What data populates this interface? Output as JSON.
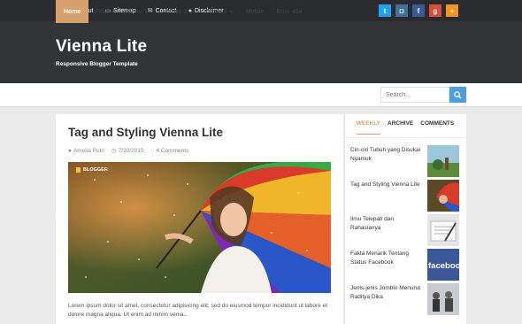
{
  "topbar": {
    "links": [
      {
        "icon": "globe-icon",
        "glyph": "◍",
        "label": "About"
      },
      {
        "icon": "folder-icon",
        "glyph": "▭",
        "label": "Sitemap"
      },
      {
        "icon": "envelope-icon",
        "glyph": "✉",
        "label": "Contact"
      },
      {
        "icon": "info-icon",
        "glyph": "●",
        "label": "Disclaimer"
      }
    ],
    "socials": [
      {
        "name": "twitter",
        "glyph": "t",
        "color": "#1da1f2"
      },
      {
        "name": "instagram",
        "glyph": "◘",
        "color": "#3f729b"
      },
      {
        "name": "facebook",
        "glyph": "f",
        "color": "#3b5998"
      },
      {
        "name": "google-plus",
        "glyph": "g",
        "color": "#dd4b39"
      },
      {
        "name": "rss",
        "glyph": "+",
        "color": "#f7931e"
      }
    ]
  },
  "header": {
    "title": "Vienna Lite",
    "description": "Responsive Blogger Template"
  },
  "nav": {
    "items": [
      {
        "label": "Home",
        "dropdown": false
      },
      {
        "label": "Fitur",
        "dropdown": true
      },
      {
        "label": "Menu 1",
        "dropdown": true
      },
      {
        "label": "Menu 2",
        "dropdown": true
      },
      {
        "label": "Menu 3",
        "dropdown": true
      },
      {
        "label": "Mobile",
        "dropdown": false
      },
      {
        "label": "Error 404",
        "dropdown": false
      }
    ],
    "search_placeholder": "Search..."
  },
  "post": {
    "title": "Tag and Styling Vienna Lite",
    "author": "Amelia Putri",
    "date": "7/30/2015",
    "comments": "4 Comments",
    "label": "BLOGGER",
    "excerpt": "Lorem ipsum dolor sit amet, consectetur adipisicing elit, sed do eiusmod tempor incididunt ut labore et dolore magna aliqua. Ut enim ad minim venia..."
  },
  "sidebar": {
    "tabs": [
      "WEEKLY",
      "ARCHIVE",
      "COMMENTS"
    ],
    "items": [
      {
        "title": "Ciri-ciri Tubuh yang Disukai Nyamuk"
      },
      {
        "title": "Tag and Styling Vienna Lite"
      },
      {
        "title": "Ilmu Telepati dan Rahasianya"
      },
      {
        "title": "Fakta Menarik Tentang Status Facebook",
        "thumb_text": "facebook"
      },
      {
        "title": "Jenis-jenis Jomblo Menurut Raditya Dika"
      }
    ]
  },
  "colors": {
    "accent": "#d8a06c",
    "topbar": "#2a2b2f",
    "header": "#333438",
    "search_button": "#4e9fdc"
  }
}
